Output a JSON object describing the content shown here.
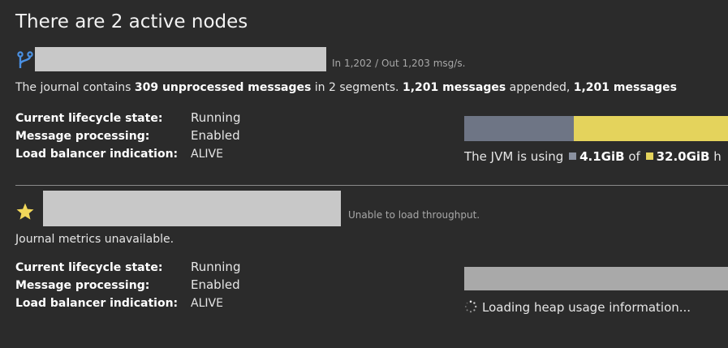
{
  "title": "There are 2 active nodes",
  "colors": {
    "background": "#2b2b2b",
    "heap_used": "#6e7585",
    "heap_max": "#e4d35c",
    "redaction": "#c8c8c8",
    "icon_blue": "#4a90e2",
    "star": "#f1d75a"
  },
  "nodes": [
    {
      "icon": "branch-icon",
      "throughput": "In 1,202 / Out 1,203 msg/s.",
      "journal": {
        "prefix": "The journal contains ",
        "unprocessed_count": "309",
        "unprocessed_label": "unprocessed messages",
        "segments_text": " in 2 segments. ",
        "appended_count": "1,201",
        "appended_label": "messages",
        "appended_suffix": " appended, ",
        "read_count": "1,201",
        "read_label": "messages"
      },
      "lifecycle_label": "Current lifecycle state:",
      "lifecycle_value": "Running",
      "processing_label": "Message processing:",
      "processing_value": "Enabled",
      "lb_label": "Load balancer indication:",
      "lb_value": "ALIVE",
      "heap": {
        "prefix": "The JVM is using ",
        "used": "4.1GiB",
        "of": " of ",
        "max": "32.0GiB",
        "suffix": " h",
        "used_fraction": 0.41
      }
    },
    {
      "icon": "star-icon",
      "throughput": "Unable to load throughput.",
      "journal_text": "Journal metrics unavailable.",
      "lifecycle_label": "Current lifecycle state:",
      "lifecycle_value": "Running",
      "processing_label": "Message processing:",
      "processing_value": "Enabled",
      "lb_label": "Load balancer indication:",
      "lb_value": "ALIVE",
      "heap_loading_text": "Loading heap usage information..."
    }
  ]
}
